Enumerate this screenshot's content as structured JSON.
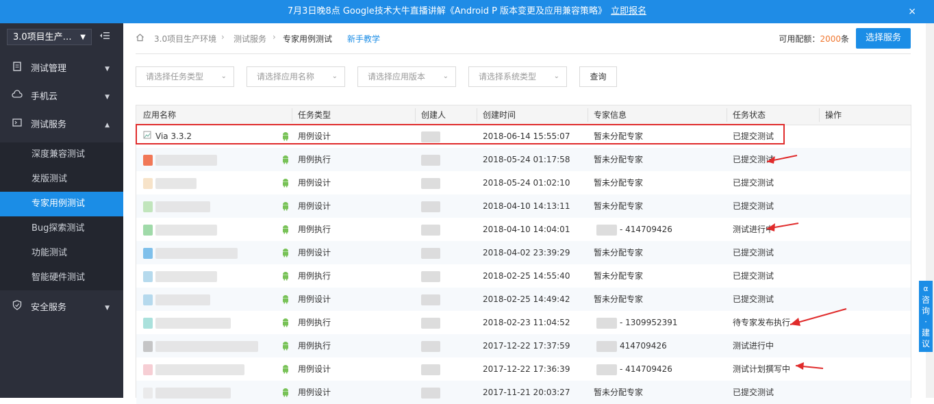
{
  "banner": {
    "text": "7月3日晚8点 Google技术大牛直播讲解《Android P 版本变更及应用兼容策略》",
    "link": "立即报名",
    "close": "×"
  },
  "sidebar": {
    "project": "3.0项目生产…",
    "nav": [
      {
        "label": "测试管理"
      },
      {
        "label": "手机云"
      },
      {
        "label": "测试服务"
      }
    ],
    "sub_items": [
      {
        "label": "深度兼容测试"
      },
      {
        "label": "发版测试"
      },
      {
        "label": "专家用例测试"
      },
      {
        "label": "Bug探索测试"
      },
      {
        "label": "功能测试"
      },
      {
        "label": "智能硬件测试"
      }
    ],
    "security": {
      "label": "安全服务"
    }
  },
  "header": {
    "crumbs": [
      "3.0项目生产环境",
      "测试服务",
      "专家用例测试"
    ],
    "tutorial": "新手教学",
    "quota_label": "可用配额：",
    "quota_value": "2000",
    "quota_unit": "条",
    "select_service": "选择服务"
  },
  "filters": {
    "task_type": "请选择任务类型",
    "app_name": "请选择应用名称",
    "app_version": "请选择应用版本",
    "system_type": "请选择系统类型",
    "query": "查询"
  },
  "table": {
    "headers": [
      "应用名称",
      "任务类型",
      "创建人",
      "创建时间",
      "专家信息",
      "任务状态",
      "操作"
    ],
    "rows": [
      {
        "app": "Via 3.3.2",
        "type": "用例设计",
        "time": "2018-06-14 15:55:07",
        "expert": "暂未分配专家",
        "status": "已提交测试"
      },
      {
        "app": "",
        "type": "用例执行",
        "time": "2018-05-24 01:17:58",
        "expert": "暂未分配专家",
        "status": "已提交测试"
      },
      {
        "app": "",
        "type": "用例设计",
        "time": "2018-05-24 01:02:10",
        "expert": "暂未分配专家",
        "status": "已提交测试"
      },
      {
        "app": "",
        "type": "用例设计",
        "time": "2018-04-10 14:13:11",
        "expert": "暂未分配专家",
        "status": "已提交测试"
      },
      {
        "app": "",
        "type": "用例执行",
        "time": "2018-04-10 14:04:01",
        "expert": "- 414709426",
        "status": "测试进行中"
      },
      {
        "app": "",
        "type": "用例设计",
        "time": "2018-04-02 23:39:29",
        "expert": "暂未分配专家",
        "status": "已提交测试"
      },
      {
        "app": "",
        "type": "用例执行",
        "time": "2018-02-25 14:55:40",
        "expert": "暂未分配专家",
        "status": "已提交测试"
      },
      {
        "app": "",
        "type": "用例设计",
        "time": "2018-02-25 14:49:42",
        "expert": "暂未分配专家",
        "status": "已提交测试"
      },
      {
        "app": "",
        "type": "用例执行",
        "time": "2018-02-23 11:04:52",
        "expert": "- 1309952391",
        "status": "待专家发布执行"
      },
      {
        "app": "",
        "type": "用例执行",
        "time": "2017-12-22 17:37:59",
        "expert": "414709426",
        "status": "测试进行中"
      },
      {
        "app": "",
        "type": "用例设计",
        "time": "2017-12-22 17:36:39",
        "expert": "- 414709426",
        "status": "测试计划撰写中"
      },
      {
        "app": "",
        "type": "用例设计",
        "time": "2017-11-21 20:03:27",
        "expert": "暂未分配专家",
        "status": "已提交测试"
      }
    ]
  },
  "feedback": "咨询·建议",
  "colors": {
    "accent": "#1b8de6",
    "sidebar": "#2c2f3a",
    "highlight": "#e02b2b",
    "android": "#78c257"
  }
}
